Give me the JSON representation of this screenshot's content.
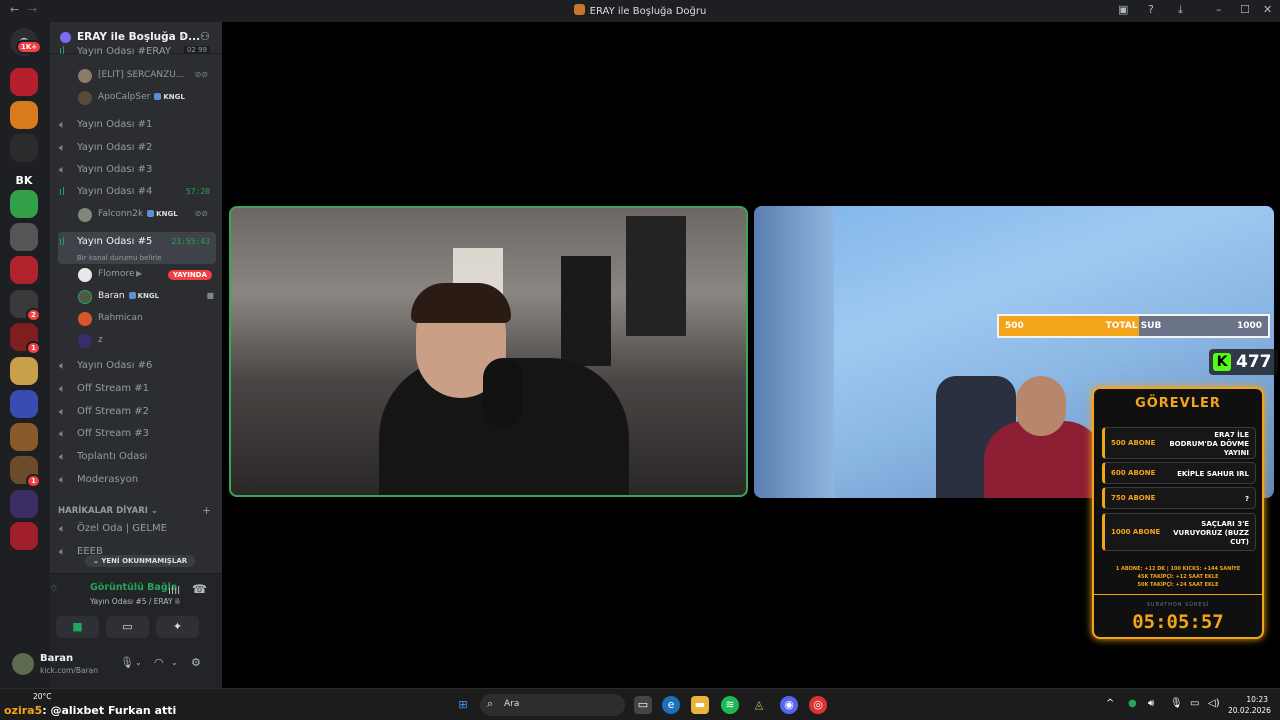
{
  "window": {
    "title": "ERAY ile Boşluğa Doğru"
  },
  "rail": {
    "home_badge": "1K+",
    "servers": [
      {
        "label": "",
        "color": "#b51f2b",
        "badge": ""
      },
      {
        "label": "",
        "color": "#d87b1f",
        "badge": ""
      },
      {
        "label": "",
        "color": "#2b2b2b",
        "badge": ""
      },
      {
        "label": "BK",
        "color": "#1e1f22",
        "badge": ""
      },
      {
        "label": "",
        "color": "#35a04a",
        "badge": ""
      },
      {
        "label": "",
        "color": "#555555",
        "badge": ""
      },
      {
        "label": "",
        "color": "#b3232c",
        "badge": ""
      },
      {
        "label": "",
        "color": "#3a3a3a",
        "badge": "2"
      },
      {
        "label": "",
        "color": "#7d1f1f",
        "badge": "1"
      },
      {
        "label": "",
        "color": "#c9a04a",
        "badge": ""
      },
      {
        "label": "",
        "color": "#3b4bb4",
        "badge": ""
      },
      {
        "label": "",
        "color": "#8b5a2b",
        "badge": ""
      },
      {
        "label": "",
        "color": "#6a4b2b",
        "badge": "1"
      },
      {
        "label": "",
        "color": "#3c2d63",
        "badge": ""
      },
      {
        "label": "",
        "color": "#a01f2b",
        "badge": ""
      }
    ]
  },
  "sidebar": {
    "server_name": "ERAY ile Boşluğa D...",
    "top_channel": {
      "label": "Yayın Odası #ERAY",
      "counts": "02  99"
    },
    "top_users": [
      {
        "name": "[ELIT] SERCANZU...",
        "tag": ""
      },
      {
        "name": "ApoCalpSer",
        "tag": "KNGL"
      }
    ],
    "channels_a": [
      {
        "label": "Yayın Odası #1"
      },
      {
        "label": "Yayın Odası #2"
      },
      {
        "label": "Yayın Odası #3"
      }
    ],
    "channel4": {
      "label": "Yayın Odası #4",
      "time": "57:20"
    },
    "channel4_user": {
      "name": "Falconn2k",
      "tag": "KNGL"
    },
    "channel5": {
      "label": "Yayın Odası #5",
      "time": "23:55:43",
      "status": "Bir kanal durumu belirle"
    },
    "channel5_users": [
      {
        "name": "Flomore",
        "live": "YAYINDA"
      },
      {
        "name": "Baran",
        "tag": "KNGL"
      },
      {
        "name": "Rahmican"
      },
      {
        "name": "z"
      }
    ],
    "channels_b": [
      {
        "label": "Yayın Odası #6"
      },
      {
        "label": "Off Stream #1"
      },
      {
        "label": "Off Stream #2"
      },
      {
        "label": "Off Stream #3"
      },
      {
        "label": "Toplantı Odası"
      },
      {
        "label": "Moderasyon"
      }
    ],
    "category": "HARİKALAR DİYARI",
    "category_channels": [
      {
        "label": "Özel Oda | GELME"
      },
      {
        "label": "EEEB"
      }
    ],
    "unread_label": "YENİ OKUNMAMIŞLAR"
  },
  "voice": {
    "connection": "Görüntülü Bağlantı Kuruldu",
    "location": "Yayın Odası #5 / ERAY ile Boşlu..."
  },
  "user": {
    "name": "Baran",
    "status": "kick.com/Baran"
  },
  "overlay": {
    "sub_bar": {
      "left": "500",
      "middle": "TOTAL SUB",
      "right": "1000",
      "progress": 0.52
    },
    "kick_count": "477",
    "tasks_title": "GÖREVLER",
    "tasks": [
      {
        "amount": "500 ABONE",
        "desc": "ERA7 İLE BODRUM'DA DÖVME YAYINI"
      },
      {
        "amount": "600 ABONE",
        "desc": "EKİPLE SAHUR IRL"
      },
      {
        "amount": "750 ABONE",
        "desc": "?"
      },
      {
        "amount": "1000 ABONE",
        "desc": "SAÇLARI 3'E VURUYORUZ (BUZZ CUT)"
      }
    ],
    "rules_line1": "1 ABONE: +12 DK  |  100 KICKS: +144 SANİYE",
    "rules_line2": "45K TAKİPÇİ: +12 SAAT EKLE",
    "rules_line3": "50K TAKİPÇİ: +24 SAAT EKLE",
    "timer_label": "SUBATHON SÜRESİ",
    "timer": "05:05:57"
  },
  "taskbar": {
    "weather": "20°C",
    "ticker_user": "ozira5",
    "ticker_text": ": @alixbet Furkan atti",
    "search": "Ara",
    "time": "10:23",
    "date": "20.02.2026"
  }
}
